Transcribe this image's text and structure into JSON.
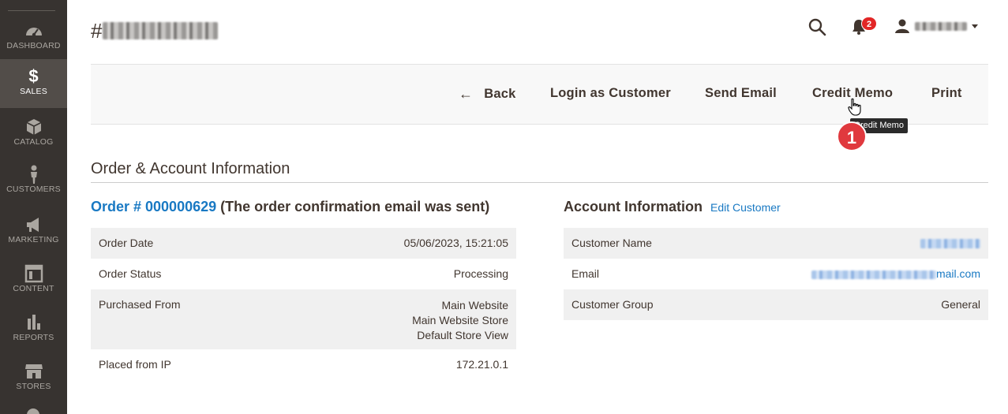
{
  "sidebar": {
    "items": [
      {
        "label": "DASHBOARD",
        "icon": "dashboard-icon",
        "active": false
      },
      {
        "label": "SALES",
        "icon": "dollar-icon",
        "active": true
      },
      {
        "label": "CATALOG",
        "icon": "box-icon",
        "active": false
      },
      {
        "label": "CUSTOMERS",
        "icon": "person-icon",
        "active": false
      },
      {
        "label": "MARKETING",
        "icon": "megaphone-icon",
        "active": false
      },
      {
        "label": "CONTENT",
        "icon": "layout-icon",
        "active": false
      },
      {
        "label": "REPORTS",
        "icon": "bar-chart-icon",
        "active": false
      },
      {
        "label": "STORES",
        "icon": "store-icon",
        "active": false
      }
    ]
  },
  "header": {
    "title_prefix": "#",
    "notifications_count": "2"
  },
  "toolbar": {
    "back_label": "Back",
    "login_as_customer_label": "Login as Customer",
    "send_email_label": "Send Email",
    "credit_memo_label": "Credit Memo",
    "print_label": "Print"
  },
  "tooltip": {
    "text": "Credit Memo"
  },
  "step_marker": "1",
  "section": {
    "title": "Order & Account Information"
  },
  "order": {
    "link_text": "Order # 000000629",
    "note": "(The order confirmation email was sent)",
    "rows": [
      {
        "label": "Order Date",
        "value": "05/06/2023, 15:21:05"
      },
      {
        "label": "Order Status",
        "value": "Processing"
      },
      {
        "label": "Purchased From",
        "value_lines": [
          "Main Website",
          "Main Website Store",
          "Default Store View"
        ]
      },
      {
        "label": "Placed from IP",
        "value": "172.21.0.1"
      }
    ]
  },
  "account": {
    "title": "Account Information",
    "edit_link": "Edit Customer",
    "rows": [
      {
        "label": "Customer Name",
        "value": ""
      },
      {
        "label": "Email",
        "value": "mail.com"
      },
      {
        "label": "Customer Group",
        "value": "General"
      }
    ]
  },
  "colors": {
    "sidebar_bg": "#373330",
    "sidebar_active": "#524d49",
    "link_blue": "#1979c3",
    "badge_red": "#e22626",
    "step_red": "#e0393e"
  }
}
